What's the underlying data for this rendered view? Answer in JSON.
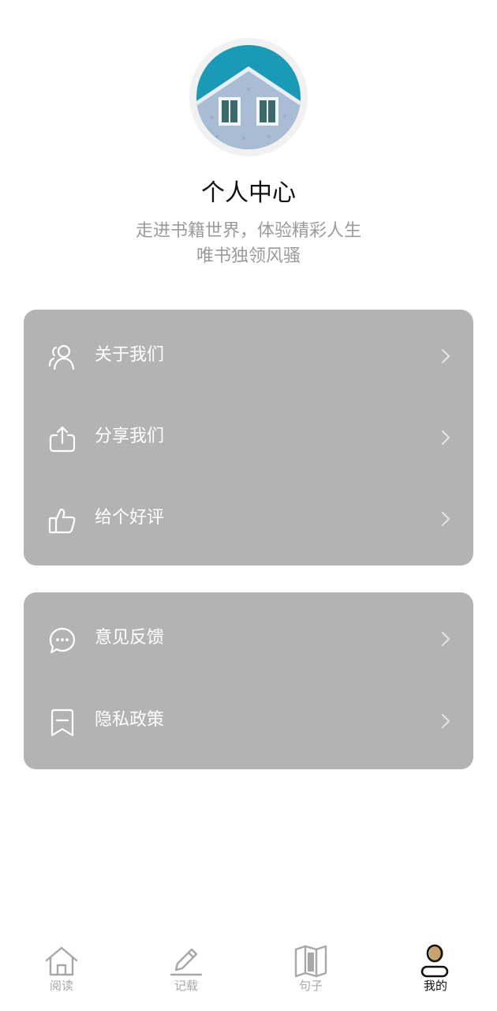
{
  "profile": {
    "title": "个人中心",
    "subtitle_line1": "走进书籍世界，体验精彩人生",
    "subtitle_line2": "唯书独领风骚"
  },
  "menu_group_1": [
    {
      "label": "关于我们",
      "icon": "users-icon"
    },
    {
      "label": "分享我们",
      "icon": "share-icon"
    },
    {
      "label": "给个好评",
      "icon": "thumbs-up-icon"
    }
  ],
  "menu_group_2": [
    {
      "label": "意见反馈",
      "icon": "chat-bubble-icon"
    },
    {
      "label": "隐私政策",
      "icon": "bookmark-icon"
    }
  ],
  "tabbar": {
    "items": [
      {
        "label": "阅读",
        "icon": "home-icon",
        "active": false
      },
      {
        "label": "记载",
        "icon": "pencil-icon",
        "active": false
      },
      {
        "label": "句子",
        "icon": "book-open-icon",
        "active": false
      },
      {
        "label": "我的",
        "icon": "person-icon",
        "active": true
      }
    ]
  },
  "colors": {
    "card_background": "#b3b3b3",
    "item_text": "#ffffff",
    "subtitle_text": "#9a9a9a",
    "tab_inactive": "#a7a7a7",
    "tab_active": "#111111",
    "avatar_accent": "#c9a46a"
  }
}
